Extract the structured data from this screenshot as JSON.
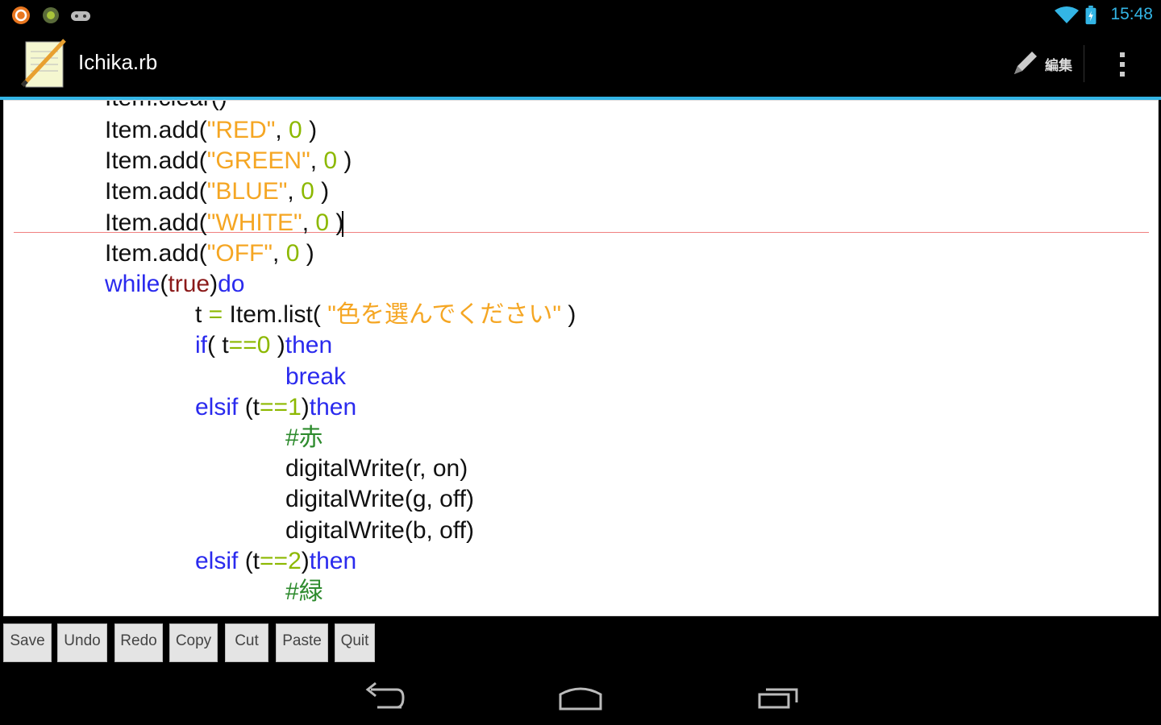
{
  "status_bar": {
    "time": "15:48",
    "notification_icons": [
      "ubuntu-icon",
      "android-icon",
      "gamepad-icon"
    ],
    "system_icons": [
      "wifi-icon",
      "battery-icon"
    ]
  },
  "action_bar": {
    "title": "Ichika.rb",
    "edit_label": "編集",
    "icons": [
      "notepad-pencil-icon",
      "pencil-icon",
      "overflow-menu-icon"
    ]
  },
  "editor": {
    "partial_top_line": "Item.clear()",
    "lines": [
      [
        {
          "t": "Item.add(",
          "c": "plain"
        },
        {
          "t": "\"RED\"",
          "c": "str"
        },
        {
          "t": ", ",
          "c": "plain"
        },
        {
          "t": "0",
          "c": "num"
        },
        {
          "t": " )",
          "c": "plain"
        }
      ],
      [
        {
          "t": "Item.add(",
          "c": "plain"
        },
        {
          "t": "\"GREEN\"",
          "c": "str"
        },
        {
          "t": ", ",
          "c": "plain"
        },
        {
          "t": "0",
          "c": "num"
        },
        {
          "t": " )",
          "c": "plain"
        }
      ],
      [
        {
          "t": "Item.add(",
          "c": "plain"
        },
        {
          "t": "\"BLUE\"",
          "c": "str"
        },
        {
          "t": ", ",
          "c": "plain"
        },
        {
          "t": "0",
          "c": "num"
        },
        {
          "t": " )",
          "c": "plain"
        }
      ],
      [
        {
          "t": "Item.add(",
          "c": "plain"
        },
        {
          "t": "\"WHITE\"",
          "c": "str"
        },
        {
          "t": ", ",
          "c": "plain"
        },
        {
          "t": "0",
          "c": "num"
        },
        {
          "t": " )",
          "c": "plain"
        },
        {
          "t": "",
          "c": "caret"
        }
      ],
      [
        {
          "t": "Item.add(",
          "c": "plain"
        },
        {
          "t": "\"OFF\"",
          "c": "str"
        },
        {
          "t": ", ",
          "c": "plain"
        },
        {
          "t": "0",
          "c": "num"
        },
        {
          "t": " )",
          "c": "plain"
        }
      ],
      [
        {
          "t": "while",
          "c": "kw"
        },
        {
          "t": "(",
          "c": "plain"
        },
        {
          "t": "true",
          "c": "bool"
        },
        {
          "t": ")",
          "c": "plain"
        },
        {
          "t": "do",
          "c": "kw"
        }
      ],
      [
        {
          "t": "t ",
          "c": "plain"
        },
        {
          "t": "=",
          "c": "op"
        },
        {
          "t": " Item.list( ",
          "c": "plain"
        },
        {
          "t": "\"色を選んでください\"",
          "c": "str"
        },
        {
          "t": " )",
          "c": "plain"
        }
      ],
      [
        {
          "t": "if",
          "c": "kw"
        },
        {
          "t": "( t",
          "c": "plain"
        },
        {
          "t": "==",
          "c": "op"
        },
        {
          "t": "0",
          "c": "num"
        },
        {
          "t": " )",
          "c": "plain"
        },
        {
          "t": "then",
          "c": "kw"
        }
      ],
      [
        {
          "t": "break",
          "c": "kw"
        }
      ],
      [
        {
          "t": "elsif",
          "c": "kw"
        },
        {
          "t": " (t",
          "c": "plain"
        },
        {
          "t": "==",
          "c": "op"
        },
        {
          "t": "1",
          "c": "num"
        },
        {
          "t": ")",
          "c": "plain"
        },
        {
          "t": "then",
          "c": "kw"
        }
      ],
      [
        {
          "t": "#赤",
          "c": "cmt"
        }
      ],
      [
        {
          "t": "digitalWrite(r, on)",
          "c": "plain"
        }
      ],
      [
        {
          "t": "digitalWrite(g, off)",
          "c": "plain"
        }
      ],
      [
        {
          "t": "digitalWrite(b, off)",
          "c": "plain"
        }
      ],
      [
        {
          "t": "elsif",
          "c": "kw"
        },
        {
          "t": " (t",
          "c": "plain"
        },
        {
          "t": "==",
          "c": "op"
        },
        {
          "t": "2",
          "c": "num"
        },
        {
          "t": ")",
          "c": "plain"
        },
        {
          "t": "then",
          "c": "kw"
        }
      ],
      [
        {
          "t": "#緑",
          "c": "cmt"
        }
      ]
    ],
    "indents": [
      0,
      0,
      0,
      0,
      0,
      0,
      1,
      1,
      2,
      1,
      2,
      2,
      2,
      2,
      1,
      2
    ]
  },
  "toolbar": {
    "buttons": [
      "Save",
      "Undo",
      "Redo",
      "Copy",
      "Cut",
      "Paste",
      "Quit"
    ]
  },
  "nav_bar": {
    "icons": [
      "back-icon",
      "home-icon",
      "recent-apps-icon"
    ]
  },
  "colors": {
    "accent": "#33b5e5",
    "keyword": "#2a2aee",
    "string": "#f5a623",
    "number": "#8cb800",
    "boolean": "#8b1a1a",
    "comment": "#2e8b2e",
    "cursor_line": "#f08080"
  }
}
